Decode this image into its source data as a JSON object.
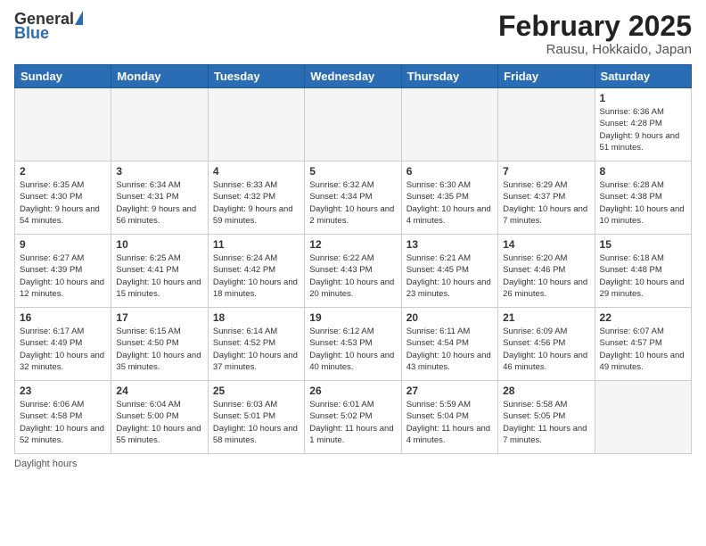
{
  "header": {
    "logo_general": "General",
    "logo_blue": "Blue",
    "title": "February 2025",
    "location": "Rausu, Hokkaido, Japan"
  },
  "days_of_week": [
    "Sunday",
    "Monday",
    "Tuesday",
    "Wednesday",
    "Thursday",
    "Friday",
    "Saturday"
  ],
  "weeks": [
    [
      {
        "num": "",
        "detail": ""
      },
      {
        "num": "",
        "detail": ""
      },
      {
        "num": "",
        "detail": ""
      },
      {
        "num": "",
        "detail": ""
      },
      {
        "num": "",
        "detail": ""
      },
      {
        "num": "",
        "detail": ""
      },
      {
        "num": "1",
        "detail": "Sunrise: 6:36 AM\nSunset: 4:28 PM\nDaylight: 9 hours and 51 minutes."
      }
    ],
    [
      {
        "num": "2",
        "detail": "Sunrise: 6:35 AM\nSunset: 4:30 PM\nDaylight: 9 hours and 54 minutes."
      },
      {
        "num": "3",
        "detail": "Sunrise: 6:34 AM\nSunset: 4:31 PM\nDaylight: 9 hours and 56 minutes."
      },
      {
        "num": "4",
        "detail": "Sunrise: 6:33 AM\nSunset: 4:32 PM\nDaylight: 9 hours and 59 minutes."
      },
      {
        "num": "5",
        "detail": "Sunrise: 6:32 AM\nSunset: 4:34 PM\nDaylight: 10 hours and 2 minutes."
      },
      {
        "num": "6",
        "detail": "Sunrise: 6:30 AM\nSunset: 4:35 PM\nDaylight: 10 hours and 4 minutes."
      },
      {
        "num": "7",
        "detail": "Sunrise: 6:29 AM\nSunset: 4:37 PM\nDaylight: 10 hours and 7 minutes."
      },
      {
        "num": "8",
        "detail": "Sunrise: 6:28 AM\nSunset: 4:38 PM\nDaylight: 10 hours and 10 minutes."
      }
    ],
    [
      {
        "num": "9",
        "detail": "Sunrise: 6:27 AM\nSunset: 4:39 PM\nDaylight: 10 hours and 12 minutes."
      },
      {
        "num": "10",
        "detail": "Sunrise: 6:25 AM\nSunset: 4:41 PM\nDaylight: 10 hours and 15 minutes."
      },
      {
        "num": "11",
        "detail": "Sunrise: 6:24 AM\nSunset: 4:42 PM\nDaylight: 10 hours and 18 minutes."
      },
      {
        "num": "12",
        "detail": "Sunrise: 6:22 AM\nSunset: 4:43 PM\nDaylight: 10 hours and 20 minutes."
      },
      {
        "num": "13",
        "detail": "Sunrise: 6:21 AM\nSunset: 4:45 PM\nDaylight: 10 hours and 23 minutes."
      },
      {
        "num": "14",
        "detail": "Sunrise: 6:20 AM\nSunset: 4:46 PM\nDaylight: 10 hours and 26 minutes."
      },
      {
        "num": "15",
        "detail": "Sunrise: 6:18 AM\nSunset: 4:48 PM\nDaylight: 10 hours and 29 minutes."
      }
    ],
    [
      {
        "num": "16",
        "detail": "Sunrise: 6:17 AM\nSunset: 4:49 PM\nDaylight: 10 hours and 32 minutes."
      },
      {
        "num": "17",
        "detail": "Sunrise: 6:15 AM\nSunset: 4:50 PM\nDaylight: 10 hours and 35 minutes."
      },
      {
        "num": "18",
        "detail": "Sunrise: 6:14 AM\nSunset: 4:52 PM\nDaylight: 10 hours and 37 minutes."
      },
      {
        "num": "19",
        "detail": "Sunrise: 6:12 AM\nSunset: 4:53 PM\nDaylight: 10 hours and 40 minutes."
      },
      {
        "num": "20",
        "detail": "Sunrise: 6:11 AM\nSunset: 4:54 PM\nDaylight: 10 hours and 43 minutes."
      },
      {
        "num": "21",
        "detail": "Sunrise: 6:09 AM\nSunset: 4:56 PM\nDaylight: 10 hours and 46 minutes."
      },
      {
        "num": "22",
        "detail": "Sunrise: 6:07 AM\nSunset: 4:57 PM\nDaylight: 10 hours and 49 minutes."
      }
    ],
    [
      {
        "num": "23",
        "detail": "Sunrise: 6:06 AM\nSunset: 4:58 PM\nDaylight: 10 hours and 52 minutes."
      },
      {
        "num": "24",
        "detail": "Sunrise: 6:04 AM\nSunset: 5:00 PM\nDaylight: 10 hours and 55 minutes."
      },
      {
        "num": "25",
        "detail": "Sunrise: 6:03 AM\nSunset: 5:01 PM\nDaylight: 10 hours and 58 minutes."
      },
      {
        "num": "26",
        "detail": "Sunrise: 6:01 AM\nSunset: 5:02 PM\nDaylight: 11 hours and 1 minute."
      },
      {
        "num": "27",
        "detail": "Sunrise: 5:59 AM\nSunset: 5:04 PM\nDaylight: 11 hours and 4 minutes."
      },
      {
        "num": "28",
        "detail": "Sunrise: 5:58 AM\nSunset: 5:05 PM\nDaylight: 11 hours and 7 minutes."
      },
      {
        "num": "",
        "detail": ""
      }
    ]
  ],
  "footer": {
    "label": "Daylight hours"
  }
}
